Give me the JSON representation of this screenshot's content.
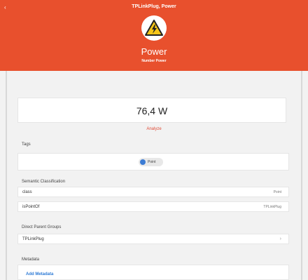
{
  "header": {
    "back_label": "‹",
    "title": "TPLinkPlug, Power",
    "icon": "warning-icon",
    "item_name": "Power",
    "item_subtitle": "Number Power",
    "color": "#e8502d"
  },
  "value": {
    "text": "76,4 W"
  },
  "analyze_label": "Analyze",
  "tags": {
    "label": "Tags",
    "chip_label": "Point",
    "chip_icon": "tag-icon"
  },
  "semantic": {
    "label": "Semantic Classification",
    "rows": [
      {
        "key": "class",
        "value": "Point"
      },
      {
        "key": "isPointOf",
        "value": "TPLinkPlug"
      }
    ]
  },
  "parent_groups": {
    "label": "Direct Parent Groups",
    "rows": [
      {
        "key": "TPLinkPlug",
        "chevron": "›"
      }
    ]
  },
  "metadata": {
    "label": "Metadata",
    "add_label": "Add Metadata"
  }
}
